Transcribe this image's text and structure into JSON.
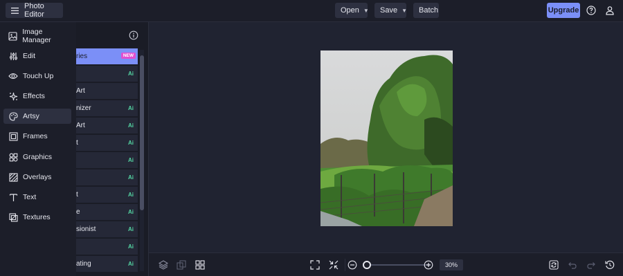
{
  "header": {
    "app_title": "Photo Editor",
    "open_label": "Open",
    "save_label": "Save",
    "batch_label": "Batch",
    "upgrade_label": "Upgrade"
  },
  "sidebar": {
    "items": [
      {
        "label": "Image Manager",
        "icon": "image-icon"
      },
      {
        "label": "Edit",
        "icon": "sliders-icon"
      },
      {
        "label": "Touch Up",
        "icon": "eye-icon"
      },
      {
        "label": "Effects",
        "icon": "sparkle-icon"
      },
      {
        "label": "Artsy",
        "icon": "palette-icon"
      },
      {
        "label": "Frames",
        "icon": "frame-icon"
      },
      {
        "label": "Graphics",
        "icon": "shapes-icon"
      },
      {
        "label": "Overlays",
        "icon": "overlay-icon"
      },
      {
        "label": "Text",
        "icon": "text-icon"
      },
      {
        "label": "Textures",
        "icon": "texture-icon"
      }
    ],
    "active": "Artsy"
  },
  "panel": {
    "items": [
      {
        "text": "ries",
        "badge": "NEW",
        "ai": ""
      },
      {
        "text": "",
        "badge": "",
        "ai": "Ai"
      },
      {
        "text": "Art",
        "badge": "",
        "ai": ""
      },
      {
        "text": "nizer",
        "badge": "",
        "ai": "Ai"
      },
      {
        "text": "Art",
        "badge": "",
        "ai": "Ai"
      },
      {
        "text": "t",
        "badge": "",
        "ai": "Ai"
      },
      {
        "text": "",
        "badge": "",
        "ai": "Ai"
      },
      {
        "text": "",
        "badge": "",
        "ai": "Ai"
      },
      {
        "text": "t",
        "badge": "",
        "ai": "Ai"
      },
      {
        "text": "e",
        "badge": "",
        "ai": "Ai"
      },
      {
        "text": "sionist",
        "badge": "",
        "ai": "Ai"
      },
      {
        "text": "",
        "badge": "",
        "ai": "Ai"
      },
      {
        "text": "ating",
        "badge": "",
        "ai": "Ai"
      }
    ]
  },
  "bottom": {
    "zoom_label": "30%",
    "zoom_percent": 30
  },
  "colors": {
    "accent": "#7b8ff7",
    "new_badge": "#e24fd0",
    "ai_badge": "#54d6a3",
    "background": "#202331"
  }
}
